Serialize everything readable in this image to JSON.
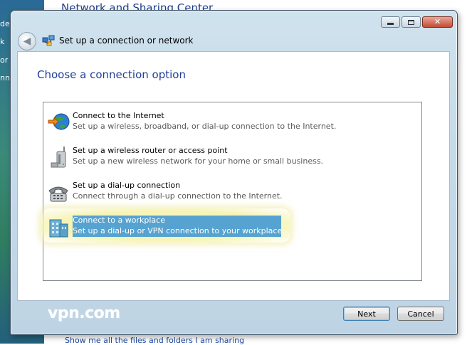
{
  "background_window": {
    "title": "Network and Sharing Center",
    "sidebar_fragments": [
      "de",
      "k",
      "or",
      "nne"
    ],
    "bottom_link": "Show me all the files and folders I am sharing"
  },
  "dialog": {
    "title": "Set up a connection or network",
    "window_buttons": {
      "minimize": "minimize-icon",
      "maximize": "maximize-icon",
      "close": "close-icon"
    },
    "back_icon": "back-arrow-icon",
    "heading": "Choose a connection option",
    "options": [
      {
        "title": "Connect to the Internet",
        "description": "Set up a wireless, broadband, or dial-up connection to the Internet.",
        "icon": "globe-icon",
        "selected": false
      },
      {
        "title": "Set up a wireless router or access point",
        "description": "Set up a new wireless network for your home or small business.",
        "icon": "router-icon",
        "selected": false
      },
      {
        "title": "Set up a dial-up connection",
        "description": "Connect through a dial-up connection to the Internet.",
        "icon": "phone-icon",
        "selected": false
      },
      {
        "title": "Connect to a workplace",
        "description": "Set up a dial-up or VPN connection to your workplace.",
        "icon": "workplace-icon",
        "selected": true
      }
    ],
    "watermark": "vpn.com",
    "buttons": {
      "next": "Next",
      "cancel": "Cancel"
    }
  },
  "colors": {
    "heading": "#1f3e96",
    "selection": "#56a3d1",
    "selection_glow": "#f6f4b4",
    "frame": "#c6dbe8"
  }
}
